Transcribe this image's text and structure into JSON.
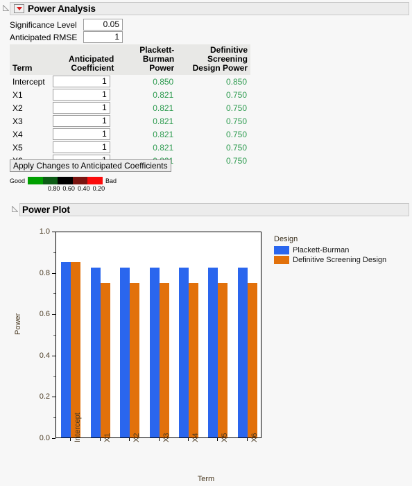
{
  "power_analysis": {
    "title": "Power Analysis",
    "significance_level_label": "Significance Level",
    "significance_level_value": "0.05",
    "anticipated_rmse_label": "Anticipated RMSE",
    "anticipated_rmse_value": "1",
    "columns": [
      "Term",
      "Anticipated Coefficient",
      "Plackett-Burman Power",
      "Definitive Screening Design Power"
    ],
    "column_lines": {
      "term": "Term",
      "coef_l1": "Anticipated",
      "coef_l2": "Coefficient",
      "pb_l1": "Plackett-",
      "pb_l2": "Burman Power",
      "dsd_l1": "Definitive Screening",
      "dsd_l2": "Design Power"
    },
    "rows": [
      {
        "term": "Intercept",
        "coefficient": "1",
        "pb_power": "0.850",
        "dsd_power": "0.850"
      },
      {
        "term": "X1",
        "coefficient": "1",
        "pb_power": "0.821",
        "dsd_power": "0.750"
      },
      {
        "term": "X2",
        "coefficient": "1",
        "pb_power": "0.821",
        "dsd_power": "0.750"
      },
      {
        "term": "X3",
        "coefficient": "1",
        "pb_power": "0.821",
        "dsd_power": "0.750"
      },
      {
        "term": "X4",
        "coefficient": "1",
        "pb_power": "0.821",
        "dsd_power": "0.750"
      },
      {
        "term": "X5",
        "coefficient": "1",
        "pb_power": "0.821",
        "dsd_power": "0.750"
      },
      {
        "term": "X6",
        "coefficient": "1",
        "pb_power": "0.821",
        "dsd_power": "0.750"
      }
    ],
    "apply_button_label": "Apply Changes to Anticipated Coefficients",
    "color_legend": {
      "good_label": "Good",
      "bad_label": "Bad",
      "ticks": [
        "0.80",
        "0.60",
        "0.40",
        "0.20"
      ],
      "band_colors": [
        "#00a000",
        "#0d5c16",
        "#000000",
        "#7a1410",
        "#fb0b0b"
      ]
    },
    "power_value_color": "#2d9b4f"
  },
  "power_plot": {
    "title": "Power Plot"
  },
  "chart_data": {
    "type": "bar",
    "title": "Power Plot",
    "xlabel": "Term",
    "ylabel": "Power",
    "categories": [
      "Intercept",
      "X1",
      "X2",
      "X3",
      "X4",
      "X5",
      "X6"
    ],
    "series": [
      {
        "name": "Plackett-Burman",
        "color": "#2a66ee",
        "values": [
          0.85,
          0.821,
          0.821,
          0.821,
          0.821,
          0.821,
          0.821
        ]
      },
      {
        "name": "Definitive Screening Design",
        "color": "#e2710b",
        "values": [
          0.85,
          0.75,
          0.75,
          0.75,
          0.75,
          0.75,
          0.75
        ]
      }
    ],
    "ylim": [
      0.0,
      1.0
    ],
    "yticks": [
      "0.0",
      "0.2",
      "0.4",
      "0.6",
      "0.8",
      "1.0"
    ],
    "ytick_values": [
      0.0,
      0.2,
      0.4,
      0.6,
      0.8,
      1.0
    ],
    "grid": false,
    "legend_title": "Design",
    "legend_position": "right"
  }
}
